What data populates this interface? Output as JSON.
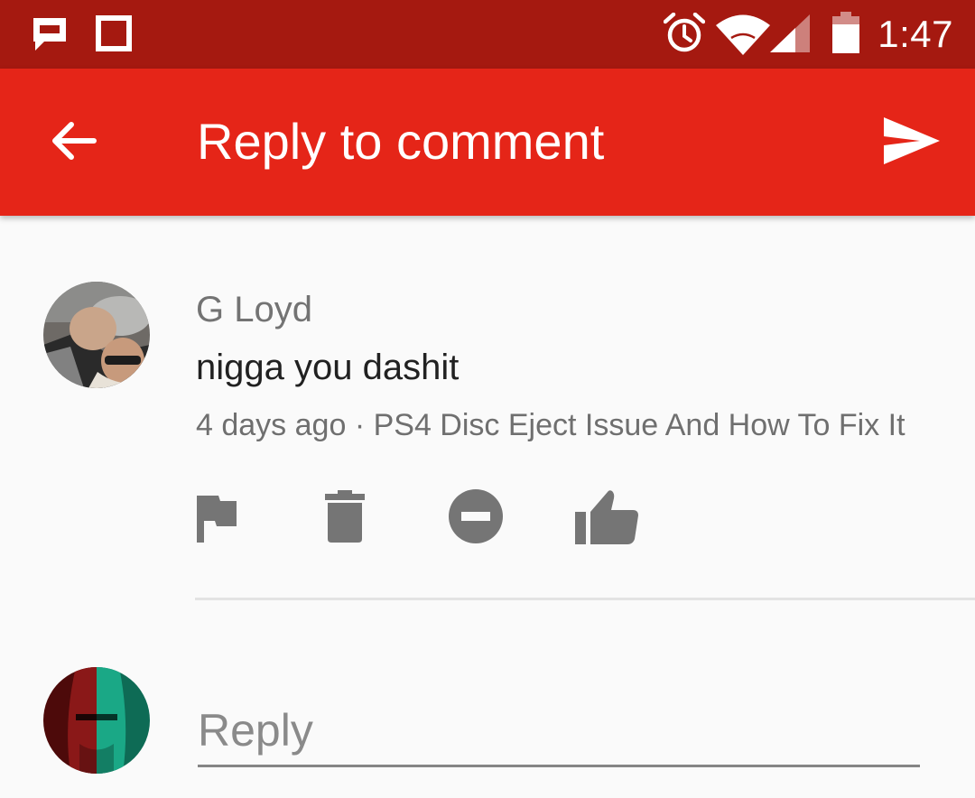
{
  "status_bar": {
    "time": "1:47",
    "left_icons": [
      "message-notification-icon",
      "square-notification-icon"
    ],
    "right_icons": [
      "alarm-icon",
      "wifi-icon",
      "cell-signal-icon",
      "battery-icon"
    ],
    "color": "#a51910"
  },
  "app_bar": {
    "title": "Reply to comment",
    "back_icon": "arrow-back-icon",
    "send_icon": "send-icon",
    "color": "#e52518"
  },
  "comment": {
    "author": "G Loyd",
    "text": "nigga you dashit",
    "age": "4 days ago",
    "separator": "·",
    "video_title": "PS4 Disc Eject Issue And How To Fix It",
    "actions": [
      "flag-icon",
      "delete-icon",
      "block-icon",
      "thumbs-up-icon"
    ]
  },
  "reply": {
    "placeholder": "Reply",
    "value": ""
  }
}
